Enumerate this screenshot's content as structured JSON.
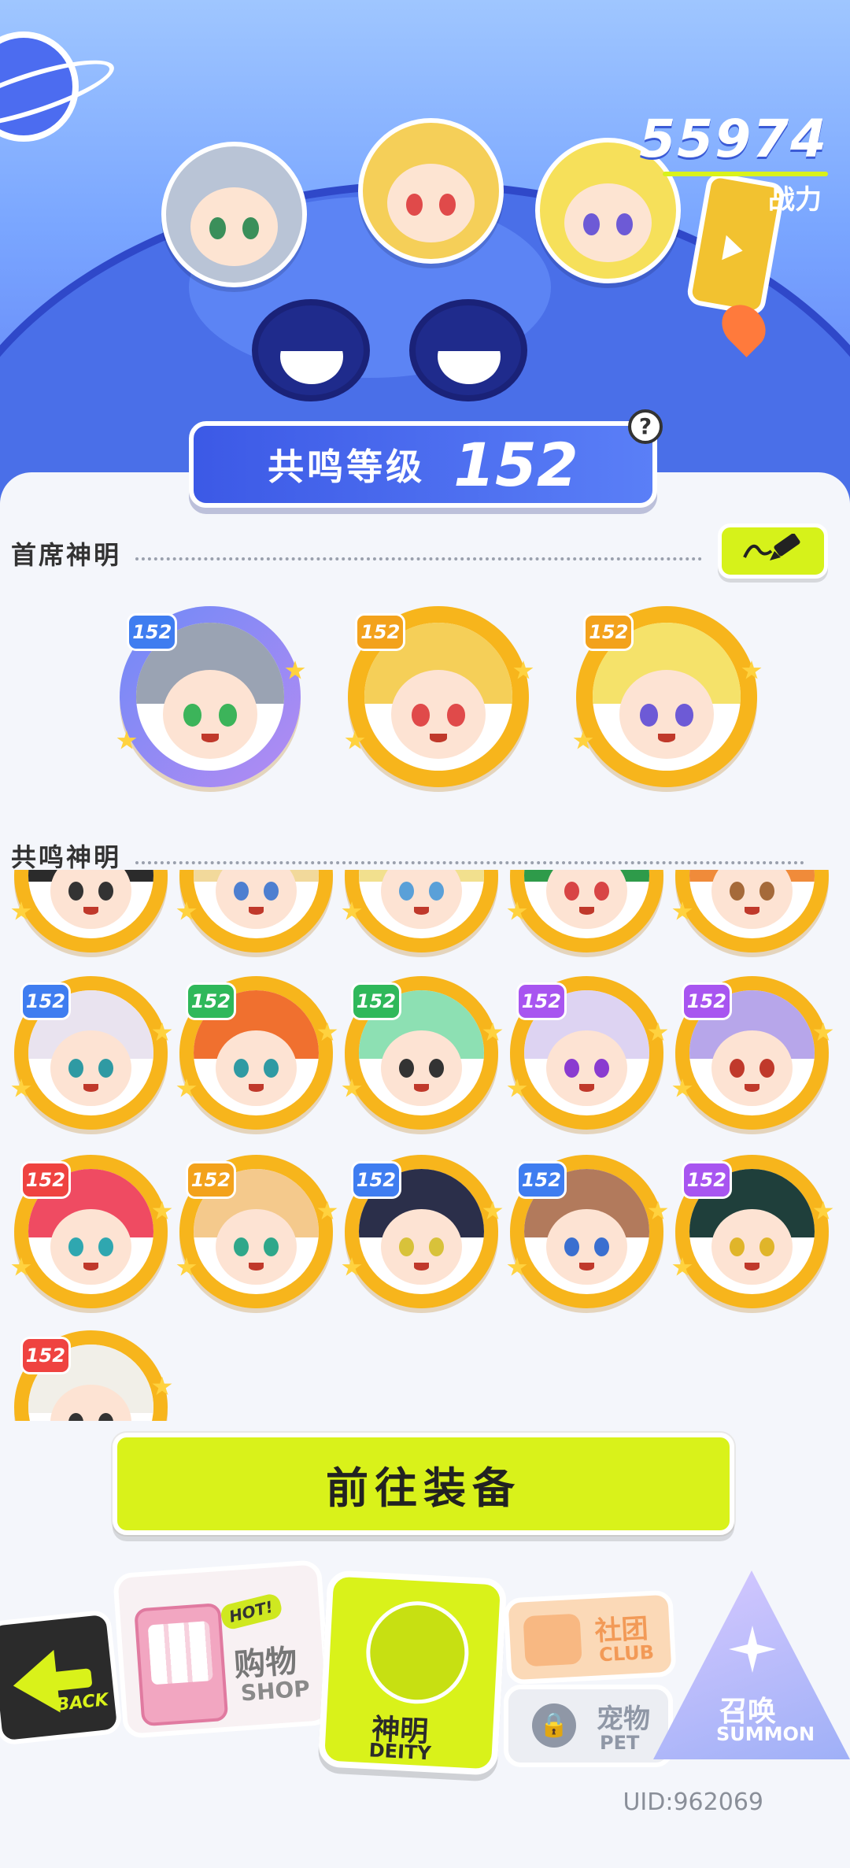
{
  "header": {
    "power_value": "55974",
    "power_label": "战力"
  },
  "resonance": {
    "label": "共鸣等级",
    "level": "152",
    "help_icon": "?"
  },
  "sections": {
    "lead": "首席神明",
    "resonant": "共鸣神明"
  },
  "lead_deities": [
    {
      "level": "152",
      "frame": "purple",
      "badge": "blue",
      "hair": "#9aa3b3",
      "eye": "#3cb45a"
    },
    {
      "level": "152",
      "frame": "gold",
      "badge": "orange",
      "hair": "#f5cf58",
      "eye": "#e04a4a"
    },
    {
      "level": "152",
      "frame": "gold",
      "badge": "orange",
      "hair": "#f5e26a",
      "eye": "#6d5ad6"
    }
  ],
  "resonant_deities": [
    {
      "level": "",
      "badge": "orange",
      "hair": "#2b2b2b",
      "eye": "#333"
    },
    {
      "level": "",
      "badge": "orange",
      "hair": "#f2d99b",
      "eye": "#4d7fd0"
    },
    {
      "level": "",
      "badge": "orange",
      "hair": "#f2e08e",
      "eye": "#5aa0d8"
    },
    {
      "level": "",
      "badge": "orange",
      "hair": "#2e9b4a",
      "eye": "#d84545"
    },
    {
      "level": "",
      "badge": "orange",
      "hair": "#f08b3a",
      "eye": "#a56a3a"
    },
    {
      "level": "152",
      "badge": "blue",
      "hair": "#e9e3ef",
      "eye": "#2f9aa3"
    },
    {
      "level": "152",
      "badge": "green",
      "hair": "#f0702f",
      "eye": "#2f9aa3"
    },
    {
      "level": "152",
      "badge": "green",
      "hair": "#8de0b3",
      "eye": "#333"
    },
    {
      "level": "152",
      "badge": "violet",
      "hair": "#ddd3f2",
      "eye": "#8a3bd0"
    },
    {
      "level": "152",
      "badge": "violet",
      "hair": "#b7a6ea",
      "eye": "#c0392b"
    },
    {
      "level": "152",
      "badge": "red",
      "hair": "#ef4b62",
      "eye": "#2fa7b0"
    },
    {
      "level": "152",
      "badge": "orange",
      "hair": "#f4c98c",
      "eye": "#2fa78a"
    },
    {
      "level": "152",
      "badge": "blue",
      "hair": "#2b2f4a",
      "eye": "#d8c23a"
    },
    {
      "level": "152",
      "badge": "blue",
      "hair": "#b27a5c",
      "eye": "#3a6fd0"
    },
    {
      "level": "152",
      "badge": "violet",
      "hair": "#1f3f3b",
      "eye": "#e0b52a"
    },
    {
      "level": "152",
      "badge": "red",
      "hair": "#f1efe8",
      "eye": "#333"
    }
  ],
  "actions": {
    "equip": "前往装备"
  },
  "nav": {
    "back_label": "BACK",
    "shop_hot": "HOT!",
    "shop_zh": "购物",
    "shop_en": "SHOP",
    "deity_zh": "神明",
    "deity_en": "DEITY",
    "club_zh": "社团",
    "club_en": "CLUB",
    "pet_zh": "宠物",
    "pet_en": "PET",
    "summon_zh": "召唤",
    "summon_en": "SUMMON"
  },
  "footer": {
    "uid": "UID:962069"
  }
}
